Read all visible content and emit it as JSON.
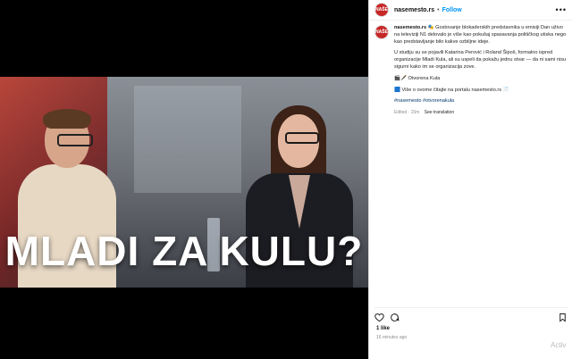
{
  "post": {
    "username": "nasemesto.rs",
    "follow_label": "Follow",
    "separator": "•",
    "more_icon": "more-dots-icon",
    "avatar_text": "NAŠE MESTO"
  },
  "media": {
    "banner_text": "MLADI ZA KULU?"
  },
  "caption": {
    "username": "nasemesto.rs",
    "p1": "🎭 Gostovanje blokaderskih predstavnika u emisiji Dan uživo na televiziji N1 delovalo je više kao pokušaj spasavanja političkog utiska nego kao predstavljanje bilo kakve ozbiljne ideje.",
    "p2": "U studiju su se pojavili Katarina Perović i Roland Šipoš, formalno ispred organizacije Mladi Kula, ali su uspeli da pokažu jednu stvar — da ni sami nisu sigurni kako im se organizacija zove.",
    "p3": "🎬🖋️ Otvorena Kula",
    "p4": "🟦 Više o ovome čitajte na portalu nasemesto.rs 📄",
    "hashtags": "#nasemesto #otvorenakula",
    "edited": "Edited · 15m",
    "see_translation": "See translation"
  },
  "footer": {
    "likes": "1 like",
    "time": "16 minutes ago",
    "watermark": "Activ"
  }
}
